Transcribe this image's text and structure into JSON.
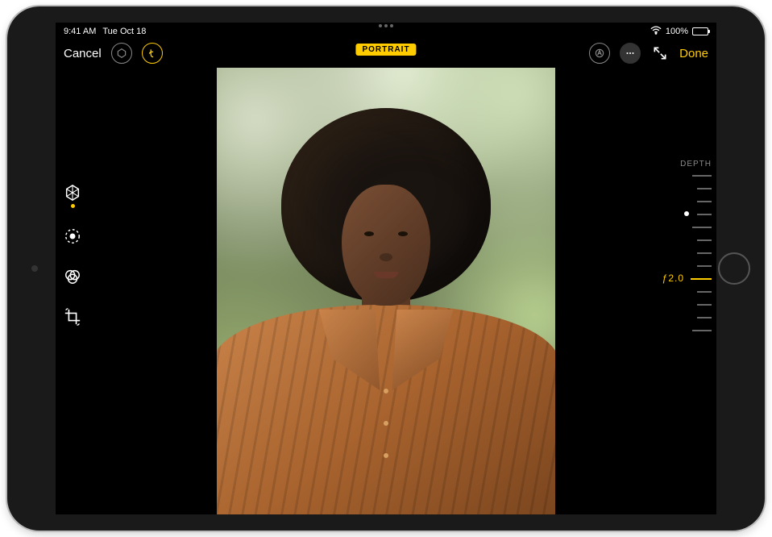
{
  "status": {
    "time": "9:41 AM",
    "date": "Tue Oct 18",
    "battery_pct": "100%"
  },
  "toolbar": {
    "cancel_label": "Cancel",
    "done_label": "Done",
    "mode_badge": "PORTRAIT"
  },
  "tools": {
    "portrait_lighting": "portrait-lighting",
    "adjust": "adjust",
    "filters": "filters",
    "crop": "crop"
  },
  "depth": {
    "title": "DEPTH",
    "value_label": "ƒ2.0"
  }
}
